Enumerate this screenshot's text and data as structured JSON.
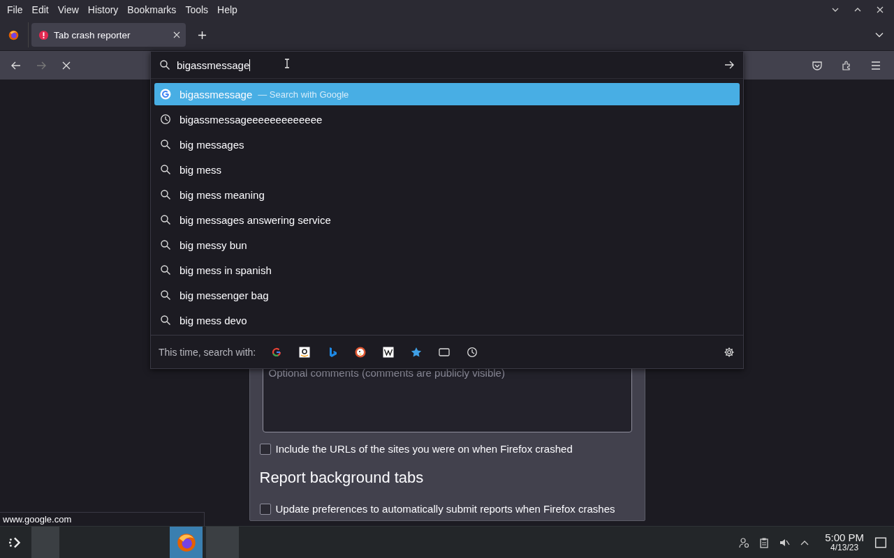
{
  "menu_bar": {
    "items": [
      {
        "label": "File"
      },
      {
        "label": "Edit"
      },
      {
        "label": "View"
      },
      {
        "label": "History"
      },
      {
        "label": "Bookmarks"
      },
      {
        "label": "Tools"
      },
      {
        "label": "Help"
      }
    ]
  },
  "tabs": [
    {
      "label": "Tab crash reporter",
      "selected": true,
      "crashed": true
    }
  ],
  "address_bar": {
    "value": "bigassmessage"
  },
  "suggestions": [
    {
      "kind": "engine",
      "text": "bigassmessage",
      "action": "— Search with Google",
      "selected": true
    },
    {
      "kind": "history",
      "text": "bigassmessageeeeeeeeeeeee",
      "selected": false
    },
    {
      "kind": "search",
      "text": "big messages",
      "selected": false
    },
    {
      "kind": "search",
      "text": "big mess",
      "selected": false
    },
    {
      "kind": "search",
      "text": "big mess meaning",
      "selected": false
    },
    {
      "kind": "search",
      "text": "big messages answering service",
      "selected": false
    },
    {
      "kind": "search",
      "text": "big messy bun",
      "selected": false
    },
    {
      "kind": "search",
      "text": "big mess in spanish",
      "selected": false
    },
    {
      "kind": "search",
      "text": "big messenger bag",
      "selected": false
    },
    {
      "kind": "search",
      "text": "big mess devo",
      "selected": false
    }
  ],
  "search_with": {
    "label": "This time, search with:",
    "engines": [
      {
        "kind": "google"
      },
      {
        "kind": "amazon"
      },
      {
        "kind": "bing"
      },
      {
        "kind": "duckduckgo"
      },
      {
        "kind": "wikipedia"
      },
      {
        "kind": "bookmarks"
      },
      {
        "kind": "tabs"
      },
      {
        "kind": "history"
      }
    ]
  },
  "crash_report": {
    "comments_placeholder": "Optional comments (comments are publicly visible)",
    "options": [
      {
        "kind": "checkbox",
        "label": "Include the URLs of the sites you were on when Firefox crashed",
        "checked": false
      },
      {
        "kind": "heading",
        "label": "Report background tabs"
      },
      {
        "kind": "checkbox",
        "label": "Update preferences to automatically submit reports when Firefox crashes",
        "checked": false
      }
    ]
  },
  "status_bar": {
    "text": "www.google.com"
  },
  "taskbar": {
    "tasks": [
      {
        "kind": "pager",
        "selected": false
      },
      {
        "kind": "firefox",
        "selected": true
      },
      {
        "kind": "blank",
        "selected": false
      }
    ],
    "clock": {
      "time": "5:00 PM",
      "date": "4/13/23"
    }
  }
}
